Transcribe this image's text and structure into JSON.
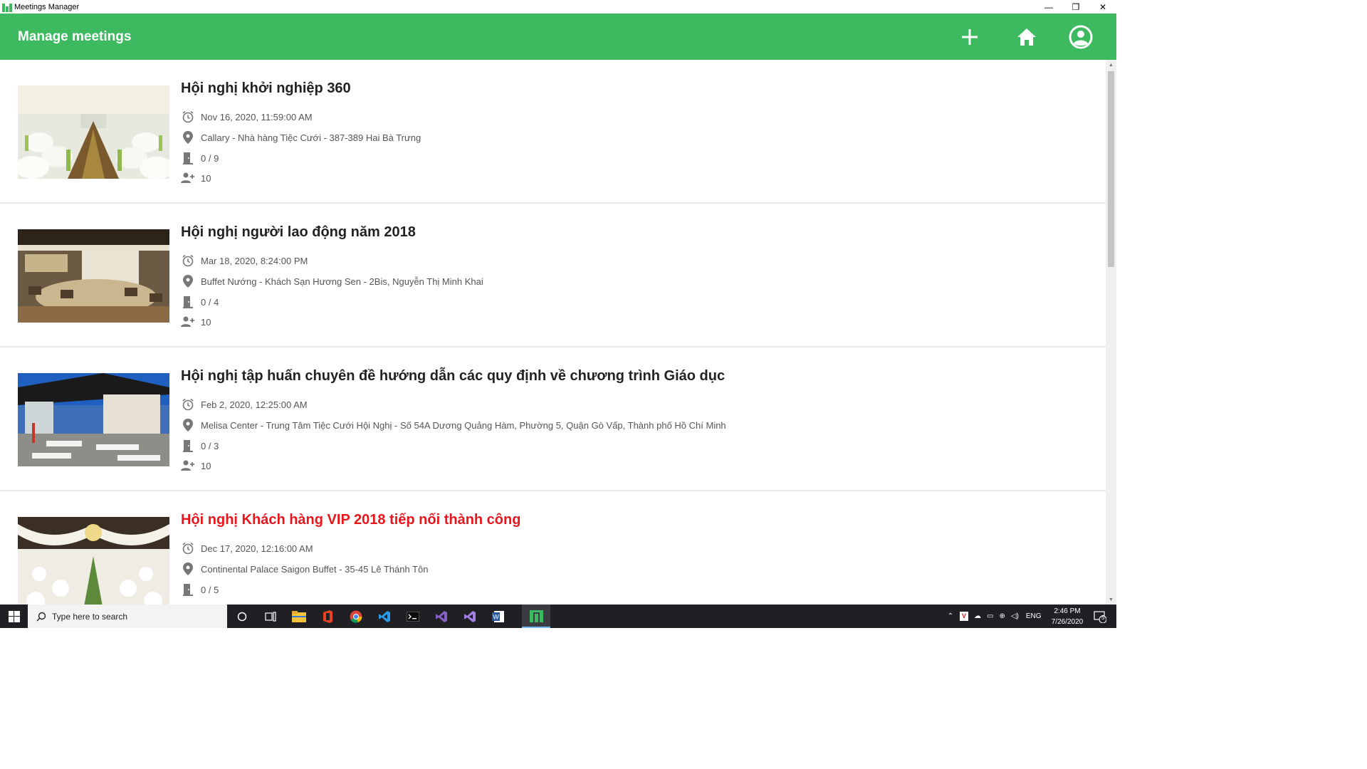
{
  "window": {
    "title": "Meetings Manager",
    "minimize_glyph": "—",
    "restore_glyph": "❐",
    "close_glyph": "✕"
  },
  "header": {
    "title": "Manage meetings",
    "icons": [
      "add-icon",
      "home-icon",
      "account-icon"
    ]
  },
  "meetings": [
    {
      "title": "Hội nghị khởi nghiệp 360",
      "datetime": "Nov 16, 2020, 11:59:00 AM",
      "location": "Callary - Nhà hàng Tiệc Cưới - 387-389 Hai Bà Trưng",
      "rooms": "0 / 9",
      "participants": "10",
      "highlight": false
    },
    {
      "title": "Hội nghị người lao động năm 2018",
      "datetime": "Mar 18, 2020, 8:24:00 PM",
      "location": "Buffet Nướng - Khách Sạn Hương Sen - 2Bis, Nguyễn Thị Minh Khai",
      "rooms": "0 / 4",
      "participants": "10",
      "highlight": false
    },
    {
      "title": "Hội nghị tập huấn chuyên đề hướng dẫn các quy định về chương trình Giáo dục",
      "datetime": "Feb 2, 2020, 12:25:00 AM",
      "location": "Melisa Center - Trung Tâm Tiệc Cưới Hội Nghị - Số 54A Dương Quảng Hàm, Phường 5, Quận Gò Vấp, Thành phố Hồ Chí Minh",
      "rooms": "0 / 3",
      "participants": "10",
      "highlight": false
    },
    {
      "title": "Hội nghị Khách hàng VIP 2018 tiếp nối thành công",
      "datetime": "Dec 17, 2020, 12:16:00 AM",
      "location": "Continental Palace Saigon Buffet - 35-45 Lê Thánh Tôn",
      "rooms": "0 / 5",
      "participants": "",
      "highlight": true
    }
  ],
  "colors": {
    "accent": "#3dba5f",
    "highlight_title": "#e8161c",
    "title": "#222222",
    "meta": "#555555"
  },
  "taskbar": {
    "search_placeholder": "Type here to search",
    "language": "ENG",
    "time": "2:46 PM",
    "date": "7/26/2020",
    "notification_count": "5"
  }
}
